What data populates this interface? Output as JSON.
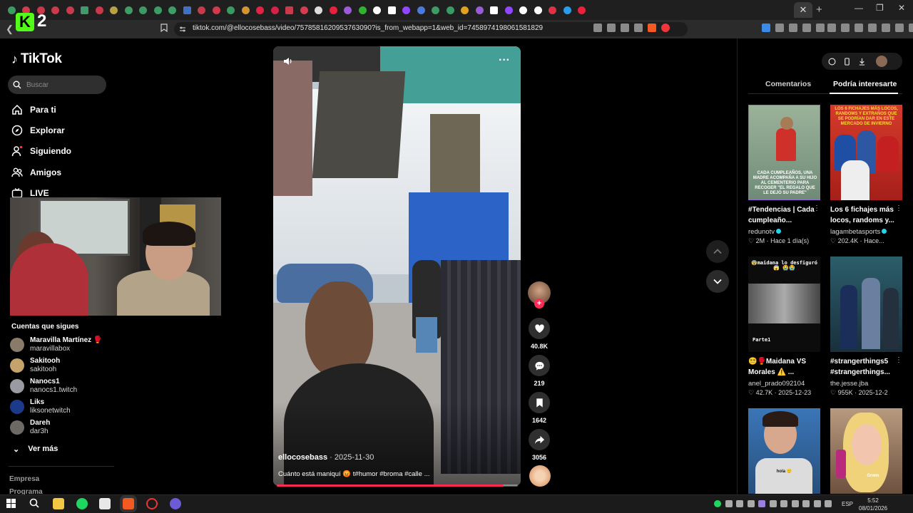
{
  "browser": {
    "url": "tiktok.com/@ellocosebass/video/7578581620953763090?is_from_webapp=1&web_id=7458974198061581829",
    "tab_favicon_colors": [
      "#3a9c62",
      "#d23b4c",
      "#c6394a",
      "#c93a4b",
      "#cb3a4c",
      "#3f9a69",
      "#c7394b",
      "#b6a144",
      "#3e9d66",
      "#3b9a62",
      "#3c9c63",
      "#3d9d64",
      "#4171c4",
      "#c8394c",
      "#cf3a4c",
      "#3a9a62",
      "#d4952f",
      "#e62144",
      "#d42145",
      "#cb3a4c",
      "#d83a51",
      "#ddd",
      "#e8213e",
      "#9b5bd6",
      "#2eb52e",
      "#fff",
      "#fff",
      "#9147ff",
      "#4a7ae0",
      "#3c9c63",
      "#3a9a62",
      "#e0a022",
      "#9b5bd6",
      "#fff",
      "#9147ff",
      "#fff",
      "#fff",
      "#e23147",
      "#2d9bea",
      "#e8213e"
    ],
    "active_tab_close": "✕",
    "new_tab": "+",
    "window_controls": [
      "—",
      "❐",
      "✕"
    ],
    "k2_logo": {
      "k": "K",
      "num": "2"
    }
  },
  "sidebar": {
    "brand": "TikTok",
    "search_placeholder": "Buscar",
    "nav": [
      {
        "label": "Para ti",
        "icon": "home-icon"
      },
      {
        "label": "Explorar",
        "icon": "compass-icon"
      },
      {
        "label": "Siguiendo",
        "icon": "following-icon"
      },
      {
        "label": "Amigos",
        "icon": "friends-icon"
      },
      {
        "label": "LIVE",
        "icon": "live-icon"
      }
    ],
    "following_title": "Cuentas que sigues",
    "following": [
      {
        "name": "Maravilla Martínez 🥊",
        "handle": "maravillabox",
        "color": "#8a7a6a"
      },
      {
        "name": "Sakitooh",
        "handle": "sakitooh",
        "color": "#c6a36b"
      },
      {
        "name": "Nanocs1",
        "handle": "nanocs1.twitch",
        "color": "#9a9aa2"
      },
      {
        "name": "Liks",
        "handle": "liksonetwitch",
        "color": "#1b3a8a"
      },
      {
        "name": "Dareh",
        "handle": "dar3h",
        "color": "#6d6a64"
      }
    ],
    "see_more": "Ver más",
    "footer": [
      "Empresa",
      "Programa"
    ]
  },
  "video": {
    "author": "ellocosebass",
    "date": "2025-11-30",
    "caption": "Cuánto está maniquí 😡 t#humor #broma #calle ...",
    "progress": 0.94
  },
  "actions": {
    "likes": "40.8K",
    "comments": "219",
    "saves": "1642",
    "shares": "3056"
  },
  "right_panel": {
    "tabs": [
      "Comentarios",
      "Podría interesarte"
    ],
    "cards": [
      {
        "title": "#Tendencias | Cada cumpleaño...",
        "user": "redunotv",
        "verified": true,
        "meta": "2M · Hace 1 día(s)",
        "overlay": "CADA CUMPLEAÑOS, UNA MADRE ACOMPAÑA A SU HIJO AL CEMENTERIO PARA RECOGER \"EL REGALO QUE LE DEJÓ SU PADRE\""
      },
      {
        "title": "Los 6 fichajes más locos, randoms y...",
        "user": "lagambetasports",
        "verified": true,
        "meta": "202.4K · Hace...",
        "overlay": "LOS 6 FICHAJES MÁS LOCOS, RANDOMS Y EXTRAÑOS QUE SE PODRÍAN DAR EN ESTE MERCADO DE INVIERNO"
      },
      {
        "title": "😵‍💫🥊Maidana VS Morales ⚠️ ...",
        "user": "anel_prado092104",
        "verified": false,
        "meta": "42.7K · 2025-12-23",
        "overlay": "😨maidana lo desfiguró😱 😭😭",
        "overlay2": "Parte1"
      },
      {
        "title": "#strangerthings5 #strangerthings...",
        "user": "the.jesse.jba",
        "verified": false,
        "meta": "955K · 2025-12-2",
        "overlay": ""
      },
      {
        "overlay": "hola 🙂"
      },
      {
        "overlay": "Grwm"
      }
    ]
  },
  "taskbar": {
    "lang": "ESP",
    "time": "5:52",
    "date": "08/01/2026"
  }
}
